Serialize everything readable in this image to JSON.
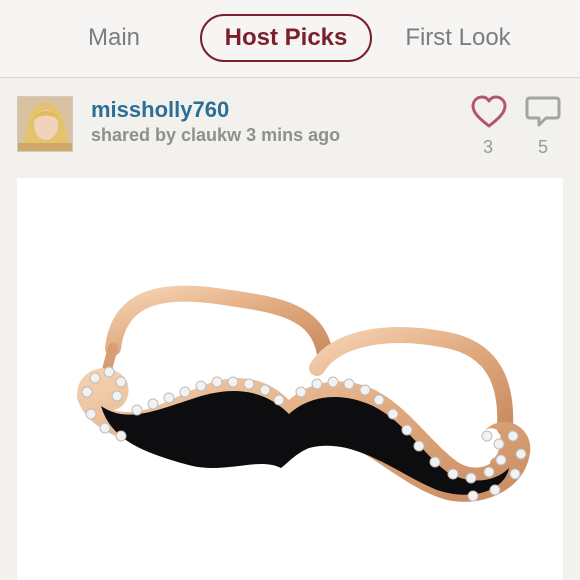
{
  "tabs": {
    "main": "Main",
    "host_picks": "Host Picks",
    "first_look": "First Look"
  },
  "post": {
    "username": "missholly760",
    "shared_by": "shared by claukw 3 mins ago",
    "likes": "3",
    "comments": "5",
    "colors": {
      "accent": "#7a1f2b",
      "username": "#2b6f97",
      "heart": "#b2566a"
    },
    "icons": {
      "like": "heart-outline-icon",
      "comment": "speech-bubble-icon"
    }
  }
}
